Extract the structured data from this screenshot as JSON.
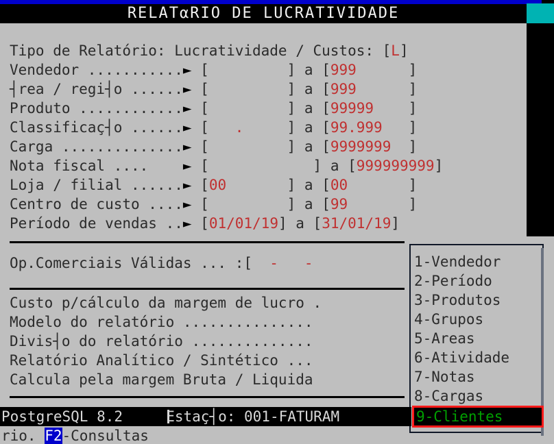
{
  "window": {
    "title": "RELATαRIO DE LUCRATIVIDADE",
    "accent_blue": "#0000cc",
    "accent_teal": "#00b3b3",
    "value_color": "#c03030",
    "selected_text_color": "#00a000",
    "selected_border_color": "#ff1a1a"
  },
  "report_type": {
    "label": "Tipo de Relatório: Lucratividade / Custos: ",
    "open_bracket": "[",
    "value": "L",
    "close_bracket": "]"
  },
  "fields": [
    {
      "label": "Vendedor ...........",
      "arrow": "►",
      "from": "",
      "from_width": 9,
      "to": "999",
      "to_width": 9
    },
    {
      "label": "┤rea / regi┤o ......",
      "arrow": "►",
      "from": "",
      "from_width": 9,
      "to": "999",
      "to_width": 9
    },
    {
      "label": "Produto ............",
      "arrow": "►",
      "from": "",
      "from_width": 9,
      "to": "99999",
      "to_width": 9
    },
    {
      "label": "Classificaç┤o ......",
      "arrow": "►",
      "from": "   .",
      "from_width": 9,
      "to": "99.999",
      "to_width": 9
    },
    {
      "label": "Carga ..............",
      "arrow": "►",
      "from": "",
      "from_width": 9,
      "to": "9999999",
      "to_width": 9
    },
    {
      "label": "Nota fiscal ....",
      "arrow": "►",
      "from": "",
      "from_width": 12,
      "to": "999999999",
      "to_width": 9
    },
    {
      "label": "Loja / filial ......",
      "arrow": "►",
      "from": "00",
      "from_width": 9,
      "to": "00",
      "to_width": 9
    },
    {
      "label": "Centro de custo ....",
      "arrow": "►",
      "from": "",
      "from_width": 9,
      "to": "99",
      "to_width": 9
    },
    {
      "label": "Período de vendas ..",
      "arrow": "►",
      "from": "01/01/19",
      "from_width": 8,
      "to": "31/01/19",
      "to_width": 8
    }
  ],
  "separator_label": "a",
  "op_comerciais": {
    "label": "Op.Comerciais Válidas ... :",
    "open_bracket": "[",
    "value": "  -   -"
  },
  "options": [
    "Custo p/cálculo da margem de lucro .",
    "Modelo do relatório ...............",
    "Divis┤o do relatório ..............",
    "Relatório Analítico / Sintético ...",
    "Calcula pela margem Bruta / Liquida"
  ],
  "menu": {
    "items": [
      {
        "label": "1-Vendedor",
        "selected": false
      },
      {
        "label": "2-Período",
        "selected": false
      },
      {
        "label": "3-Produtos",
        "selected": false
      },
      {
        "label": "4-Grupos",
        "selected": false
      },
      {
        "label": "5-Areas",
        "selected": false
      },
      {
        "label": "6-Atividade",
        "selected": false
      },
      {
        "label": "7-Notas",
        "selected": false
      },
      {
        "label": "8-Cargas",
        "selected": false
      },
      {
        "label": "9-Clientes",
        "selected": true
      }
    ]
  },
  "status": {
    "database": "PostgreSQL 8.2",
    "station": "Estaç┤o: 001-FATURAM",
    "hint_prefix": "rio. ",
    "hint_key": "F2",
    "hint_suffix": "-Consultas"
  }
}
